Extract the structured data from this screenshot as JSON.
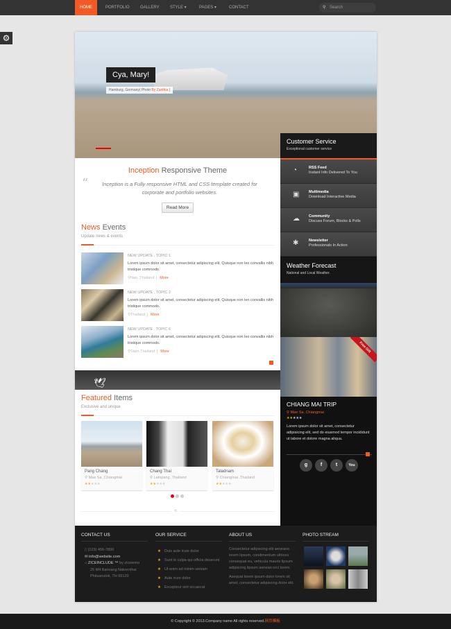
{
  "nav": {
    "items": [
      "HOME",
      "PORTFOLIO",
      "GALLERY",
      "STYLE ▾",
      "PAGES ▾",
      "CONTACT"
    ],
    "search_placeholder": "Search"
  },
  "hero": {
    "caption": "Cya, Mary!",
    "sub_prefix": "Hamburg, Germany( Photo ",
    "sub_author": "By Zanthia",
    "sub_suffix": " )",
    "panel_title": "Customer Service",
    "panel_sub": "Exceptional customer service"
  },
  "intro": {
    "title_accent": "Inception",
    "title_rest": " Responsive Theme",
    "quote": "Inception is a Fully responsive HTML and CSS template created for corporate and portfolio websites.",
    "button": "Read More"
  },
  "news": {
    "title_accent": "News",
    "title_rest": " Events",
    "subtitle": "Update news & events",
    "items": [
      {
        "topic": "NEW UPDATE , TOPIC 1",
        "body": "Lorem ipsum dolor sit amet, consectetur adipiscing elit. Quisque non leo convallis nibh tristique commodo.",
        "location": "Nan ,Thailand",
        "more": "More"
      },
      {
        "topic": "NEW UPDATE , TOPIC 2",
        "body": "Lorem ipsum dolor sit amet, consectetur adipiscing elit. Quisque non leo convallis nibh tristique commodo.",
        "location": "Thailand",
        "more": "More"
      },
      {
        "topic": "NEW UPDATE , TOPIC 6",
        "body": "Lorem ipsum dolor sit amet, consectetur adipiscing elit. Quisque non leo convallis nibh tristique commodo.",
        "location": "Siam,Thailand",
        "more": "More"
      }
    ]
  },
  "featured": {
    "title_accent": "Featured",
    "title_rest": " Items",
    "subtitle": "Exclusive and unique",
    "items": [
      {
        "name": "Pang Chang",
        "location": "Mae Sa ,Chiangmai",
        "rating": 2
      },
      {
        "name": "Chang Thai",
        "location": "Lampang ,Thailand",
        "rating": 2
      },
      {
        "name": "Taladnam",
        "location": "Chiangmai ,Thailand",
        "rating": 2
      }
    ],
    "page": 1,
    "pages": 3
  },
  "sidebar": {
    "items": [
      {
        "icon": "rss-icon",
        "title": "RSS Feed",
        "sub": "Instant Info Delivered To You"
      },
      {
        "icon": "image-icon",
        "title": "Multimedia",
        "sub": "Download Interactive Media"
      },
      {
        "icon": "cloud-icon",
        "title": "Community",
        "sub": "Discuss Forum, Blocks & Polls"
      },
      {
        "icon": "gear-icon",
        "title": "Newsletter",
        "sub": "Professionals In Action"
      }
    ],
    "weather_title": "Weather Forecast",
    "weather_sub": "National and Local Weather.",
    "ribbon": "Free Gift",
    "trip": {
      "title": "CHIANG MAI TRIP",
      "location": "Mae Sa ,Chiangmai",
      "rating": 2,
      "body": "Lorem ipsum dolor sit amet, consectetur adipisicing elit, sed do eiusmod tempor incididunt ut labore et dolore magna aliqua."
    },
    "social": [
      "g",
      "f",
      "t",
      "You"
    ]
  },
  "footer": {
    "contact_title": "CONTACT US",
    "phone": "(123) 456-7890",
    "email": "info@website.com",
    "company": "ZICEINCLUDE ™",
    "company_by": " by ziceiemo",
    "addr1": "25 M4 Banvang Nakornthai",
    "addr2": "Phitsanulok, TH 65120",
    "service_title": "OUR SERVICE",
    "services": [
      "Duis aute irure dolor",
      "Sunt in culpa qui officia deserunt",
      "Ut enim ad minim veniam",
      "Aute irure dolor",
      "Excepteur sint occaecat"
    ],
    "about_title": "ABOUT US",
    "about1": "Consectetur adipiscing elit aeneane lorem lipsum, condimentum ultrices consequat eu, vehicula mauris lipsum adipiscing lipsum aenean orci lorem.",
    "about2": "Asequat lorem ipsum dolor lorem sit amet, consectetur adipiscing dolor elit.",
    "photo_title": "PHOTO STREAM"
  },
  "copyright": {
    "text": "© Copyright © 2013.Company name All rights reserved.",
    "link": "网页模板"
  },
  "colors": {
    "accent": "#f15a24",
    "nav": "#333333",
    "footer": "#1c1c1c"
  }
}
